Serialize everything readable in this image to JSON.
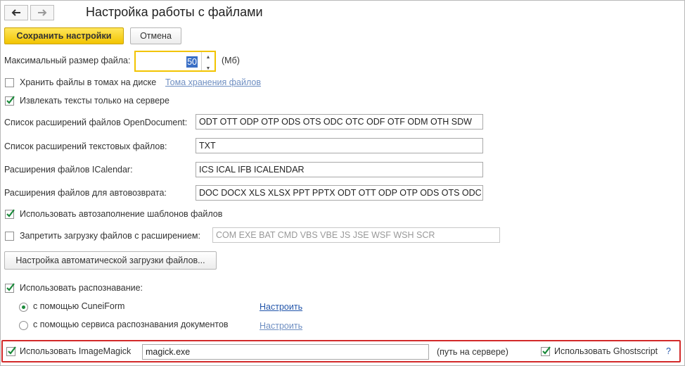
{
  "window": {
    "title": "Настройка работы с файлами"
  },
  "toolbar": {
    "save_label": "Сохранить настройки",
    "cancel_label": "Отмена"
  },
  "max_size": {
    "label": "Максимальный размер файла:",
    "value": "50",
    "unit": "(Мб)"
  },
  "store_in_volumes": {
    "label": "Хранить файлы в томах на диске",
    "checked": false,
    "link": "Тома хранения файлов"
  },
  "extract_server": {
    "label": "Извлекать тексты только на сервере",
    "checked": true
  },
  "opendocument": {
    "label": "Список расширений файлов OpenDocument:",
    "value": "ODT OTT ODP OTP ODS OTS ODC OTC ODF OTF ODM OTH SDW"
  },
  "text_ext": {
    "label": "Список расширений текстовых файлов:",
    "value": "TXT"
  },
  "icalendar": {
    "label": "Расширения файлов ICalendar:",
    "value": "ICS ICAL IFB ICALENDAR"
  },
  "autoreturn": {
    "label": "Расширения файлов для автовозврата:",
    "value": "DOC DOCX XLS XLSX PPT PPTX ODT OTT ODP OTP ODS OTS ODC"
  },
  "autofill": {
    "label": "Использовать автозаполнение шаблонов файлов",
    "checked": true
  },
  "forbid": {
    "label": "Запретить загрузку файлов с расширением:",
    "checked": false,
    "value": "COM EXE BAT CMD VBS VBE JS JSE WSF WSH SCR"
  },
  "auto_load_button": "Настройка автоматической загрузки файлов...",
  "recognition": {
    "label": "Использовать распознавание:",
    "checked": true,
    "options": [
      {
        "label": "с помощью CuneiForm",
        "selected": true,
        "link": "Настроить"
      },
      {
        "label": "с помощью сервиса распознавания документов",
        "selected": false,
        "link": "Настроить"
      }
    ]
  },
  "imagemagick": {
    "label": "Использовать ImageMagick",
    "checked": true,
    "value": "magick.exe",
    "hint": "(путь на сервере)",
    "ghostscript_label": "Использовать Ghostscript",
    "ghostscript_checked": true,
    "help": "?"
  },
  "colors": {
    "accent_yellow": "#f2c400",
    "highlight_red": "#d22a2a",
    "check_green": "#1a8a3a",
    "link_blue": "#2255aa"
  },
  "icons": {
    "back": "arrow-left-icon",
    "forward": "arrow-right-icon",
    "check": "checkmark-icon"
  }
}
